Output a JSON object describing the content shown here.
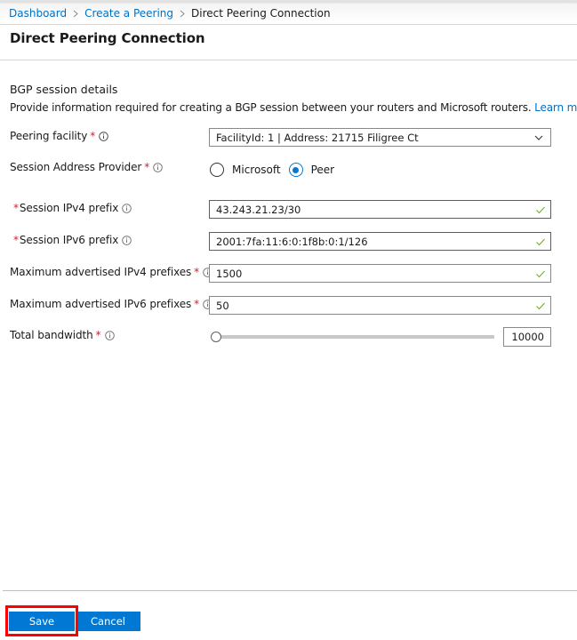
{
  "breadcrumb": {
    "items": [
      {
        "label": "Dashboard",
        "link": true
      },
      {
        "label": "Create a Peering",
        "link": true
      },
      {
        "label": "Direct Peering Connection",
        "link": false
      }
    ]
  },
  "page": {
    "title": "Direct Peering Connection"
  },
  "section": {
    "title": "BGP session details",
    "description": "Provide information required for creating a BGP session between your routers and Microsoft routers.",
    "learn_more": "Learn more"
  },
  "form": {
    "peering_facility": {
      "label": "Peering facility",
      "required_mark": "*",
      "value": "FacilityId: 1 | Address: 21715 Filigree Ct"
    },
    "session_address_provider": {
      "label": "Session Address Provider",
      "required_mark": "*",
      "options": [
        {
          "label": "Microsoft",
          "checked": false
        },
        {
          "label": "Peer",
          "checked": true
        }
      ]
    },
    "session_ipv4_prefix": {
      "label": "Session IPv4 prefix",
      "required_mark": "*",
      "value": "43.243.21.23/30",
      "valid": true
    },
    "session_ipv6_prefix": {
      "label": "Session IPv6 prefix",
      "required_mark": "*",
      "value": "2001:7fa:11:6:0:1f8b:0:1/126",
      "valid": true
    },
    "max_ipv4_prefixes": {
      "label": "Maximum advertised IPv4 prefixes",
      "required_mark": "*",
      "value": "1500",
      "valid": true
    },
    "max_ipv6_prefixes": {
      "label": "Maximum advertised IPv6 prefixes",
      "required_mark": "*",
      "value": "50",
      "valid": true
    },
    "total_bandwidth": {
      "label": "Total bandwidth",
      "required_mark": "*",
      "value": "10000",
      "slider_fraction": 0
    }
  },
  "footer": {
    "save_label": "Save",
    "cancel_label": "Cancel"
  },
  "colors": {
    "accent": "#0078d4",
    "link": "#0072c6",
    "required": "#c4262e",
    "valid_check": "#6bb700",
    "highlight": "#ff0000",
    "focused_border": "#8a3aa5"
  }
}
